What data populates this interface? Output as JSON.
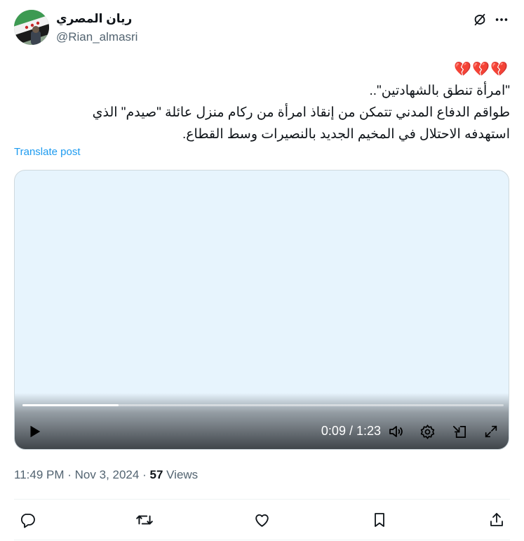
{
  "author": {
    "display_name": "ريان المصري",
    "handle": "@Rian_almasri",
    "avatar_icon": "syrian-revolution-flag-avatar"
  },
  "header_actions": {
    "grok_icon": "grok-slash-icon",
    "more_icon": "more-dots-icon"
  },
  "tweet": {
    "emojis": "💔💔💔",
    "lines": [
      "\"امرأة تنطق بالشهادتين\"..",
      "طواقم الدفاع المدني تتمكن من إنقاذ امرأة من ركام منزل عائلة \"صيدم\" الذي",
      "استهدفه الاحتلال في المخيم الجديد بالنصيرات وسط القطاع."
    ],
    "translate_label": "Translate post"
  },
  "video": {
    "background_color": "#e7f4fd",
    "time_label": "0:09 / 1:23",
    "progress": 0.2,
    "controls": [
      "play-icon",
      "volume-icon",
      "settings-gear-icon",
      "pip-icon",
      "fullscreen-icon"
    ]
  },
  "meta": {
    "time": "11:49 PM",
    "separator": "·",
    "date": "Nov 3, 2024",
    "views_count": "57",
    "views_label": "Views"
  },
  "actions": [
    "reply-icon",
    "repost-icon",
    "like-icon",
    "bookmark-icon",
    "share-icon"
  ],
  "colors": {
    "link": "#1d9bf0",
    "secondary_text": "#536471",
    "primary_text": "#0f1419",
    "heart_emoji": "#dd2e44"
  }
}
